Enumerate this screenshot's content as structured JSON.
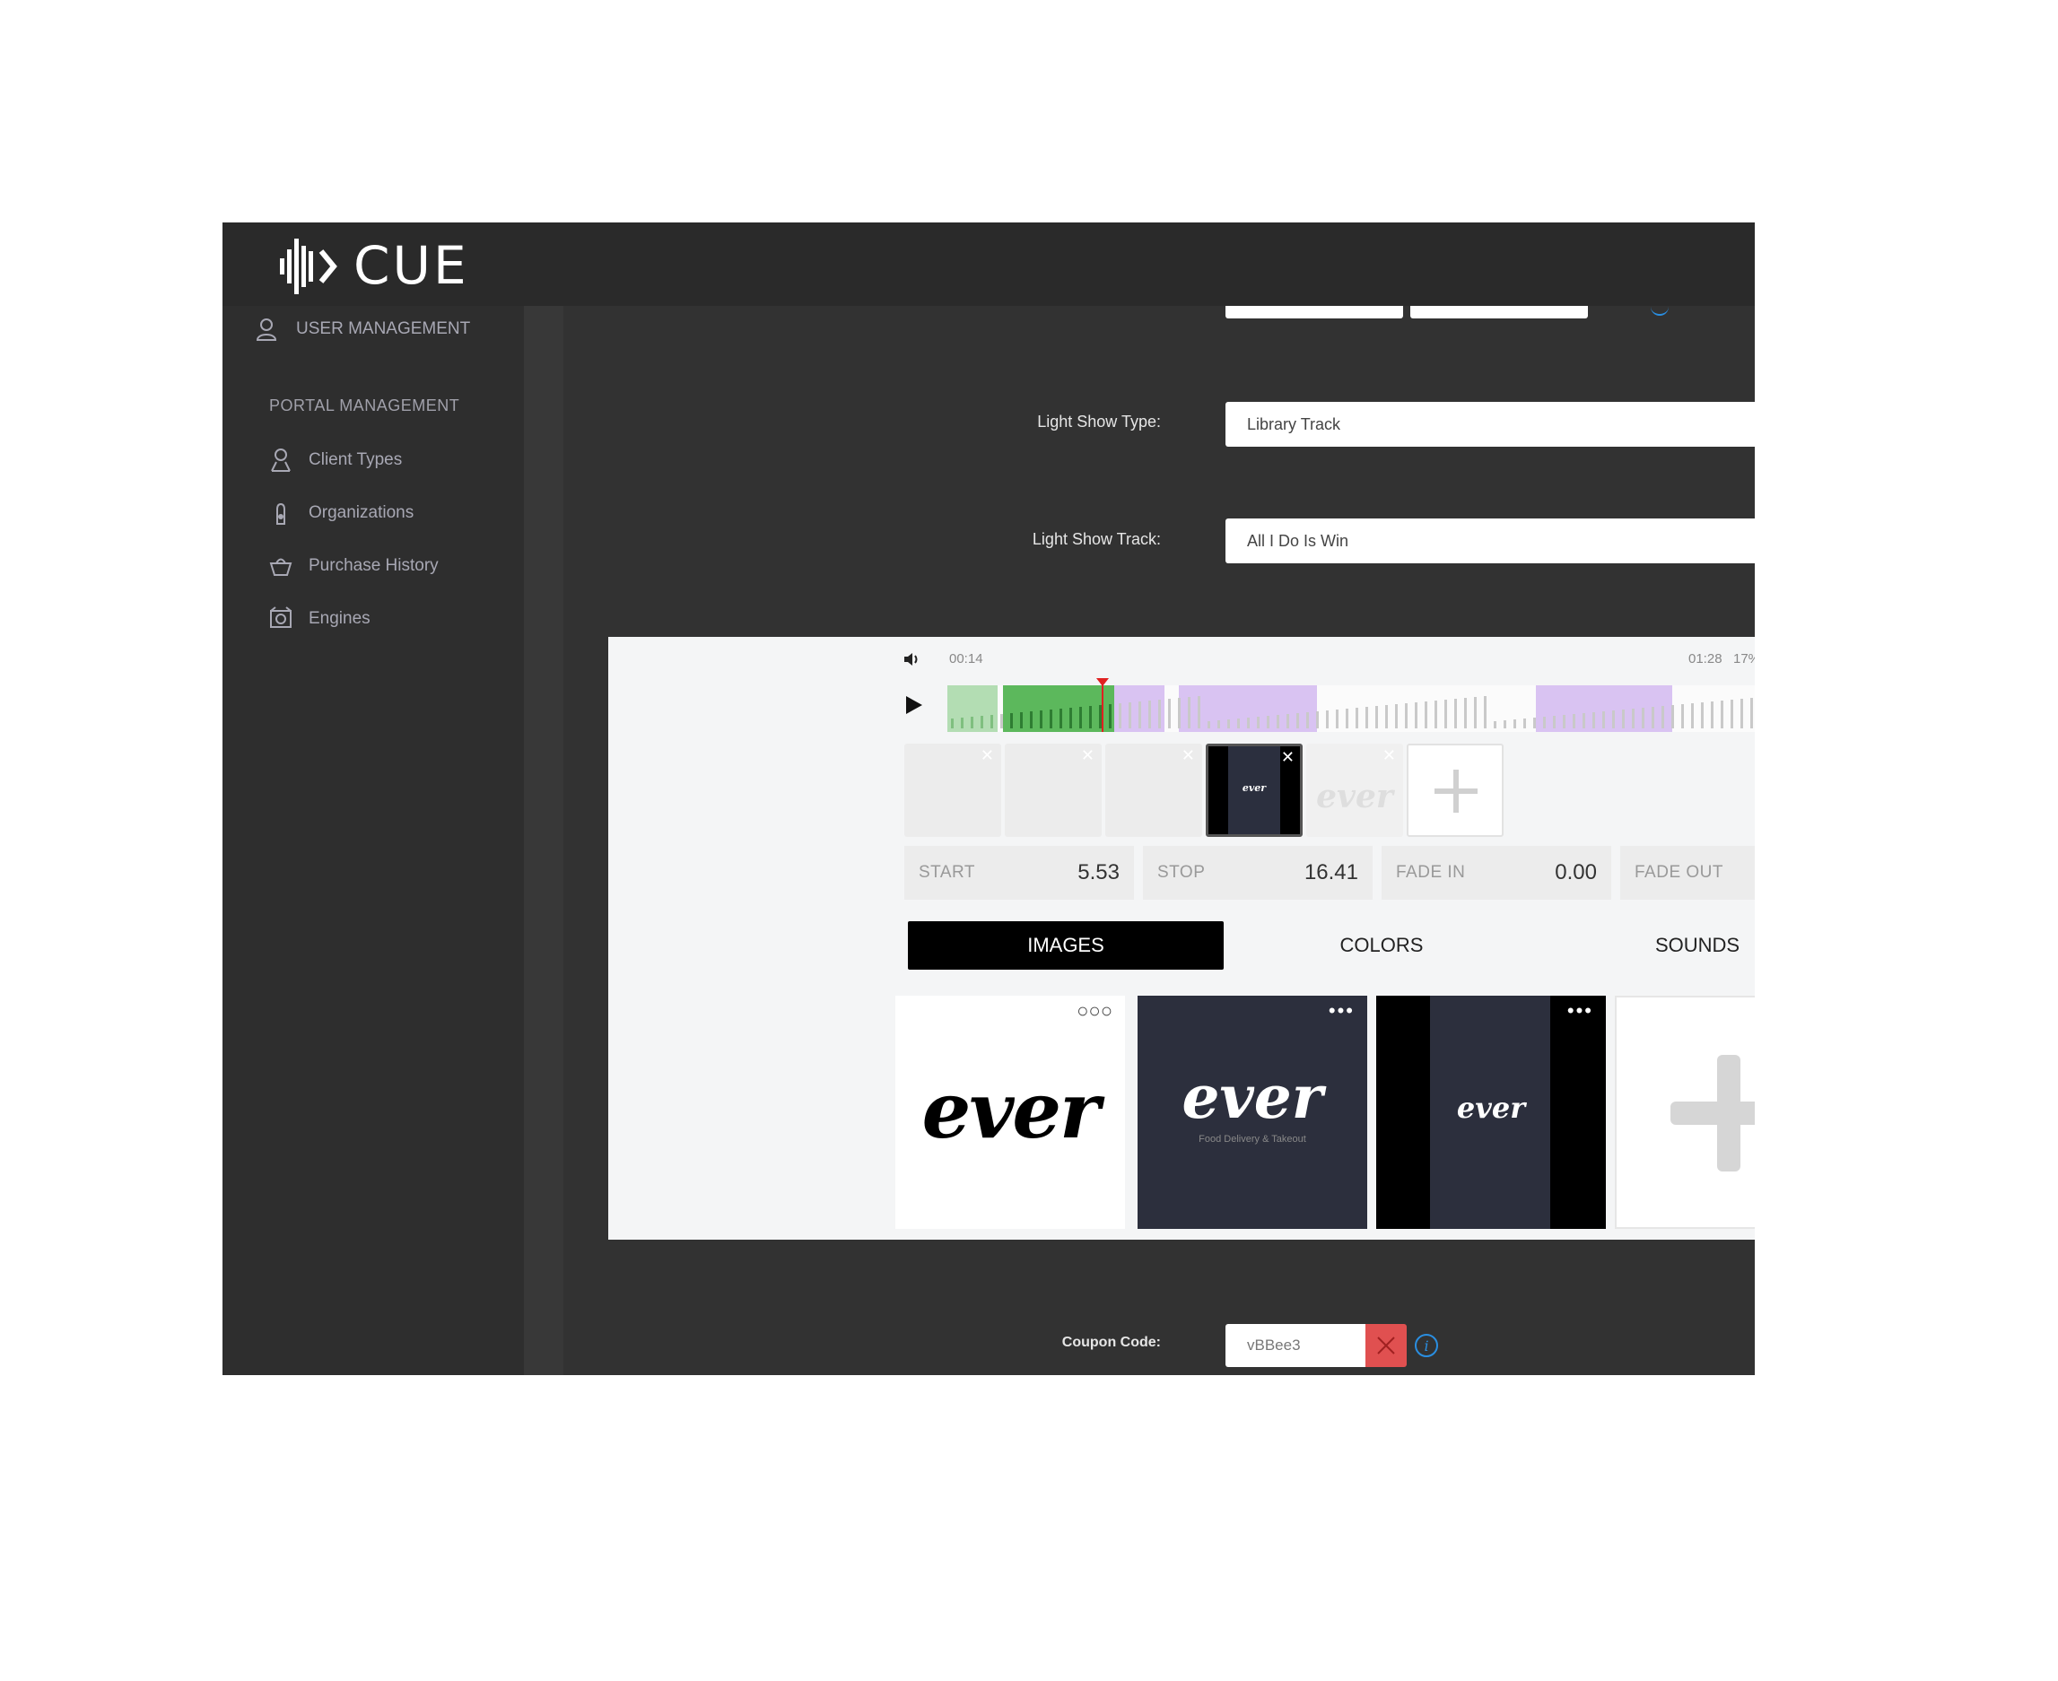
{
  "app": {
    "logo_text": "CUE"
  },
  "sidebar": {
    "user_management": "USER MANAGEMENT",
    "portal_section_title": "PORTAL MANAGEMENT",
    "items": [
      {
        "label": "Client Types",
        "icon": "person-icon"
      },
      {
        "label": "Organizations",
        "icon": "hand-icon"
      },
      {
        "label": "Purchase History",
        "icon": "basket-icon"
      },
      {
        "label": "Engines",
        "icon": "engine-icon"
      }
    ]
  },
  "form": {
    "light_show_type_label": "Light Show Type:",
    "light_show_type_value": "Library Track",
    "light_show_track_label": "Light Show Track:",
    "light_show_track_value": "All I Do Is Win",
    "coupon_label": "Coupon Code:",
    "coupon_value": "vBBee3"
  },
  "player": {
    "current_time": "00:14",
    "end_time": "01:28",
    "zoom": "17%"
  },
  "timing": {
    "start_label": "START",
    "start_value": "5.53",
    "stop_label": "STOP",
    "stop_value": "16.41",
    "fade_in_label": "FADE IN",
    "fade_in_value": "0.00",
    "fade_out_label": "FADE OUT"
  },
  "tabs": {
    "images": "IMAGES",
    "colors": "COLORS",
    "sounds": "SOUNDS"
  },
  "media": {
    "slot_thumb_text": "ever",
    "faded_thumb_text": "ever",
    "card1_text": "ever",
    "card2_text": "ever",
    "card2_subtitle": "Food Delivery & Takeout",
    "card3_text": "ever"
  },
  "colors": {
    "accent_green": "#5cb85c",
    "accent_purple": "#d9c3f2",
    "playhead_red": "#e02020",
    "clear_button_red": "#e05050",
    "info_blue": "#2a8ee0"
  }
}
